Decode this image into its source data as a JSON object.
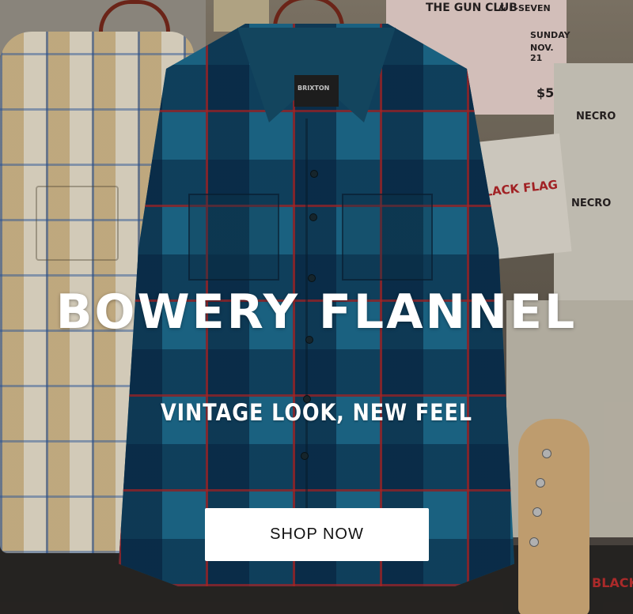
{
  "hero": {
    "headline": "BOWERY FLANNEL",
    "subhead": "VINTAGE LOOK, NEW FEEL",
    "cta_label": "SHOP NOW",
    "colors": {
      "text": "#ffffff",
      "cta_background": "#ffffff",
      "cta_text": "#111111",
      "flannel_base": "#1e6f92",
      "flannel_stripe": "#be2828"
    }
  },
  "background": {
    "poster_gun_club": "THE GUN CLUB",
    "poster_l_seven": "& L-SEVEN",
    "poster_sunday": "SUNDAY",
    "poster_date": "NOV. 21",
    "poster_price": "$5",
    "poster_black_flag": "BLACK FLAG",
    "poster_necro": "NECRO",
    "poster_black": "BLACK",
    "shirt_tag": "BRIXTON"
  }
}
